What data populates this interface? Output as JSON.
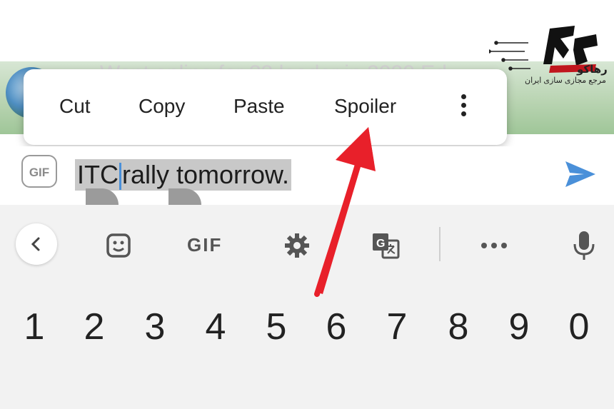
{
  "chat": {
    "background_text": "Want online for 33 leader in 2020 Ed"
  },
  "context_menu": {
    "cut": "Cut",
    "copy": "Copy",
    "paste": "Paste",
    "spoiler": "Spoiler"
  },
  "input": {
    "gif_label": "GIF",
    "text_before_caret": "ITC",
    "text_after_caret": "rally tomorrow."
  },
  "keyboard": {
    "toolbar_gif_label": "GIF",
    "number_row": [
      "1",
      "2",
      "3",
      "4",
      "5",
      "6",
      "7",
      "8",
      "9",
      "0"
    ]
  },
  "watermark": {
    "brand": "رهاکو",
    "tagline": "مرجع مجازی سازی ایران"
  },
  "colors": {
    "send": "#4a90d9",
    "arrow": "#e8202a",
    "selection": "#c8c8c8"
  },
  "icons": [
    "more-vert-icon",
    "send-icon",
    "chevron-left-icon",
    "sticker-icon",
    "settings-icon",
    "translate-icon",
    "more-horiz-icon",
    "mic-icon"
  ]
}
